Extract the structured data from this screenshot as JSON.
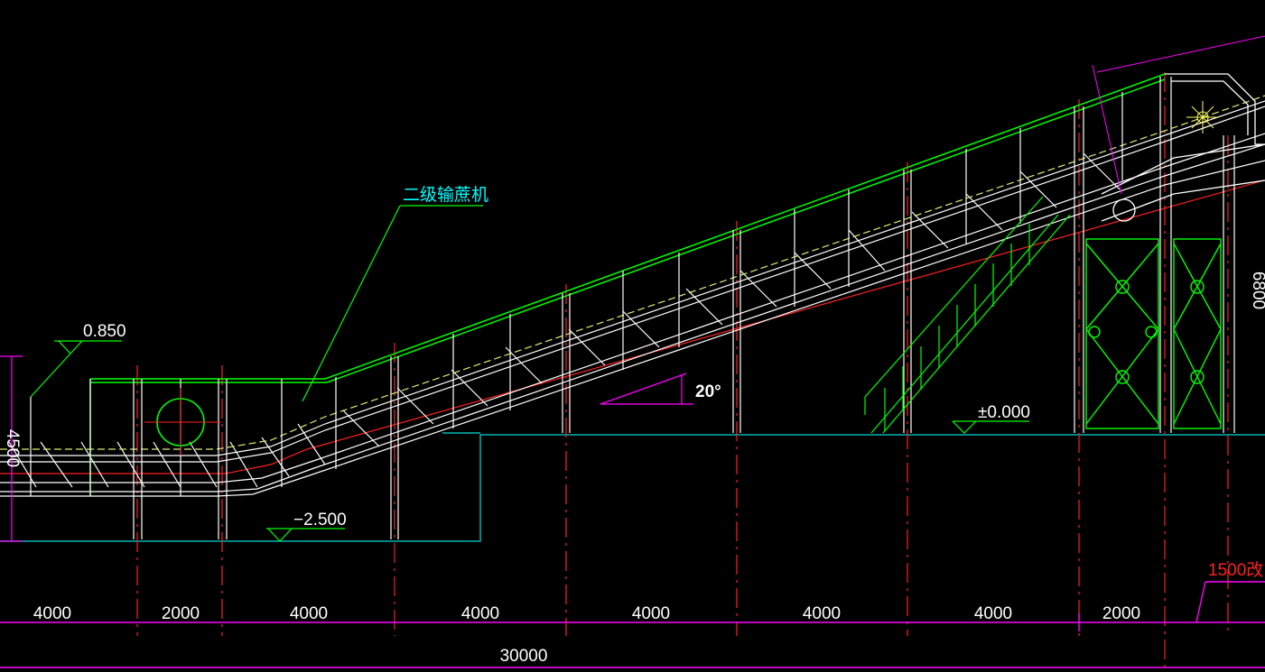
{
  "labels": {
    "conveyor": "二级输蔗机",
    "elev_top": "0.850",
    "elev_zero": "±0.000",
    "elev_pit": "−2.500",
    "angle": "20°",
    "height_left": "4500",
    "height_right": "6800",
    "revision": "1500改"
  },
  "dimensions": {
    "segments": [
      "4000",
      "2000",
      "4000",
      "4000",
      "4000",
      "4000",
      "4000",
      "2000"
    ],
    "total": "30000"
  },
  "colors": {
    "background": "#000000",
    "structure": "#ffffff",
    "frame": "#00ff00",
    "centerline": "#ff2020",
    "dimension": "#ff00ff",
    "ground": "#00b4b4",
    "leader": "#00ff00",
    "title_text": "#00ffff"
  }
}
